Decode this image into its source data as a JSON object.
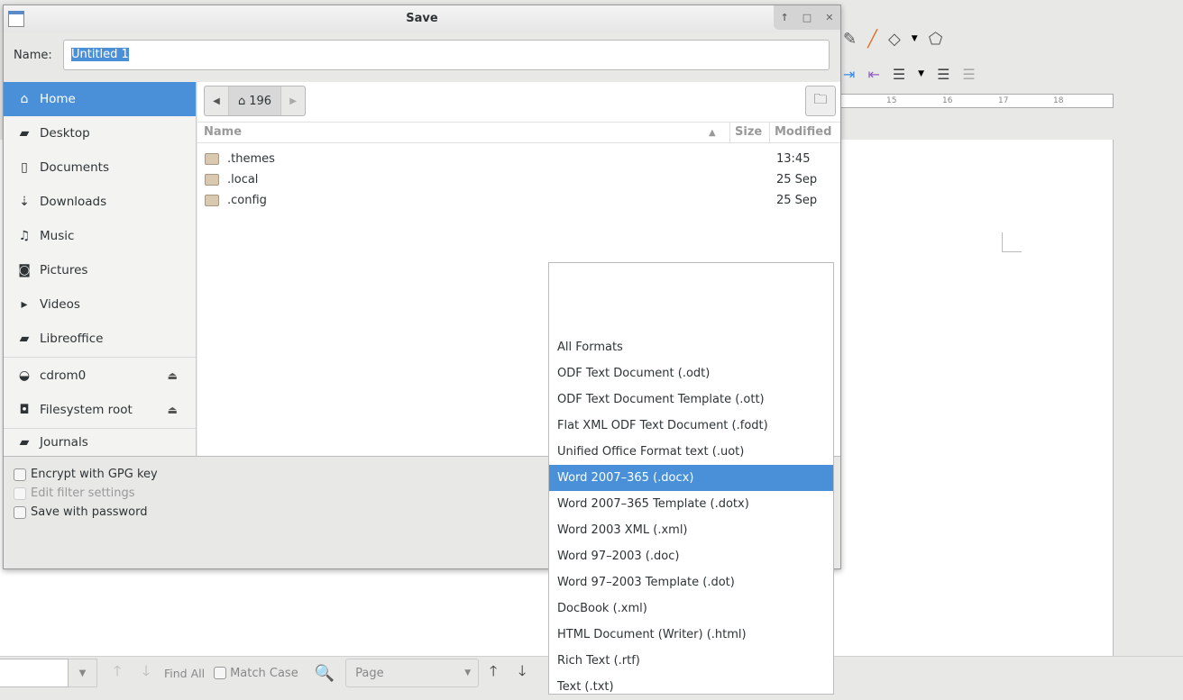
{
  "dialog": {
    "title": "Save",
    "name_label": "Name:",
    "name_value": "Untitled 1",
    "window_controls": [
      "↑",
      "□",
      "✕"
    ]
  },
  "sidebar": {
    "items": [
      {
        "label": "Home",
        "icon": "home-icon"
      },
      {
        "label": "Desktop",
        "icon": "folder-icon"
      },
      {
        "label": "Documents",
        "icon": "document-icon"
      },
      {
        "label": "Downloads",
        "icon": "download-icon"
      },
      {
        "label": "Music",
        "icon": "music-icon"
      },
      {
        "label": "Pictures",
        "icon": "camera-icon"
      },
      {
        "label": "Videos",
        "icon": "video-icon"
      },
      {
        "label": "Libreoffice",
        "icon": "folder-icon"
      }
    ],
    "devices": [
      {
        "label": "cdrom0"
      },
      {
        "label": "Filesystem root"
      }
    ],
    "bookmarks": [
      {
        "label": "Journals"
      }
    ]
  },
  "pathbar": {
    "current": "196"
  },
  "columns": {
    "name": "Name",
    "size": "Size",
    "modified": "Modified"
  },
  "files": [
    {
      "name": ".themes",
      "size": "",
      "modified": "13:45"
    },
    {
      "name": ".local",
      "size": "",
      "modified": "25 Sep"
    },
    {
      "name": ".config",
      "size": "",
      "modified": "25 Sep"
    }
  ],
  "options": [
    {
      "label": "Encrypt with GPG key",
      "enabled": true
    },
    {
      "label": "Edit filter settings",
      "enabled": false
    },
    {
      "label": "Save with password",
      "enabled": true
    }
  ],
  "formats": {
    "selected": "Word 2007–365 (.docx)",
    "items": [
      "All Formats",
      "ODF Text Document (.odt)",
      "ODF Text Document Template (.ott)",
      "Flat XML ODF Text Document (.fodt)",
      "Unified Office Format text (.uot)",
      "Word 2007–365 (.docx)",
      "Word 2007–365 Template (.dotx)",
      "Word 2003 XML (.xml)",
      "Word 97–2003 (.doc)",
      "Word 97–2003 Template (.dot)",
      "DocBook (.xml)",
      "HTML Document (Writer) (.html)",
      "Rich Text (.rtf)",
      "Text (.txt)"
    ]
  },
  "ruler": {
    "ticks": [
      "15",
      "16",
      "17",
      "18"
    ]
  },
  "findbar": {
    "find_all": "Find All",
    "match_case": "Match Case",
    "search_in": "Page"
  },
  "colors": {
    "accent": "#4a90d9"
  }
}
